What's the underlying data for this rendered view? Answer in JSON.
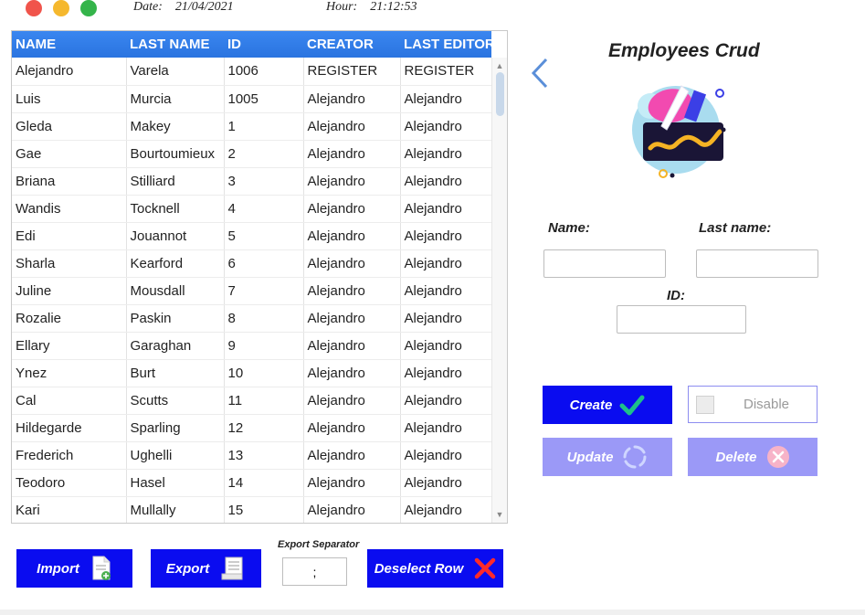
{
  "header": {
    "date_label": "Date:",
    "date_value": "21/04/2021",
    "hour_label": "Hour:",
    "hour_value": "21:12:53"
  },
  "table": {
    "columns": [
      "NAME",
      "LAST NAME",
      "ID",
      "CREATOR",
      "LAST EDITOR"
    ],
    "rows": [
      [
        "Alejandro",
        "Varela",
        "1006",
        "REGISTER",
        "REGISTER"
      ],
      [
        "Luis",
        "Murcia",
        "1005",
        "Alejandro",
        "Alejandro"
      ],
      [
        "Gleda",
        "Makey",
        "1",
        "Alejandro",
        "Alejandro"
      ],
      [
        "Gae",
        "Bourtoumieux",
        "2",
        "Alejandro",
        "Alejandro"
      ],
      [
        "Briana",
        "Stilliard",
        "3",
        "Alejandro",
        "Alejandro"
      ],
      [
        "Wandis",
        "Tocknell",
        "4",
        "Alejandro",
        "Alejandro"
      ],
      [
        "Edi",
        "Jouannot",
        "5",
        "Alejandro",
        "Alejandro"
      ],
      [
        "Sharla",
        "Kearford",
        "6",
        "Alejandro",
        "Alejandro"
      ],
      [
        "Juline",
        "Mousdall",
        "7",
        "Alejandro",
        "Alejandro"
      ],
      [
        "Rozalie",
        "Paskin",
        "8",
        "Alejandro",
        "Alejandro"
      ],
      [
        "Ellary",
        "Garaghan",
        "9",
        "Alejandro",
        "Alejandro"
      ],
      [
        "Ynez",
        "Burt",
        "10",
        "Alejandro",
        "Alejandro"
      ],
      [
        "Cal",
        "Scutts",
        "11",
        "Alejandro",
        "Alejandro"
      ],
      [
        "Hildegarde",
        "Sparling",
        "12",
        "Alejandro",
        "Alejandro"
      ],
      [
        "Frederich",
        "Ughelli",
        "13",
        "Alejandro",
        "Alejandro"
      ],
      [
        "Teodoro",
        "Hasel",
        "14",
        "Alejandro",
        "Alejandro"
      ],
      [
        "Kari",
        "Mullally",
        "15",
        "Alejandro",
        "Alejandro"
      ]
    ]
  },
  "toolbar": {
    "import_label": "Import",
    "export_label": "Export",
    "separator_label": "Export Separator",
    "separator_value": ";",
    "deselect_label": "Deselect Row"
  },
  "panel": {
    "title": "Employees Crud",
    "name_label": "Name:",
    "last_name_label": "Last name:",
    "id_label": "ID:",
    "name_value": "",
    "last_name_value": "",
    "id_value": "",
    "create_label": "Create",
    "disable_label": "Disable",
    "update_label": "Update",
    "delete_label": "Delete"
  },
  "colors": {
    "primary_blue": "#0a0cf0",
    "header_blue": "#2f80ed",
    "disabled_purple": "#9b99f7"
  }
}
